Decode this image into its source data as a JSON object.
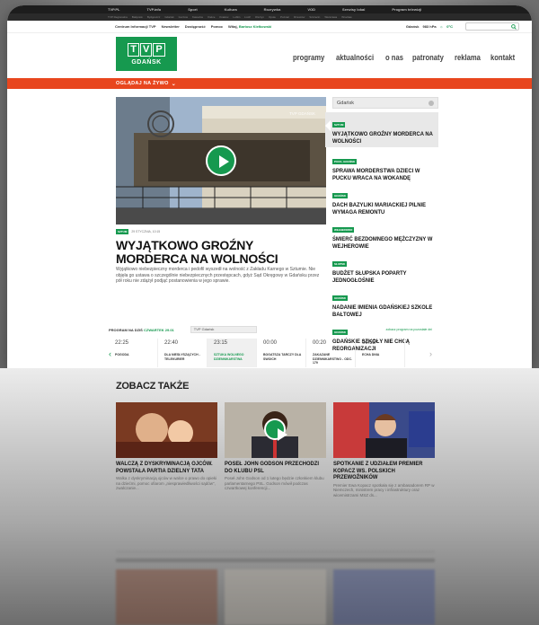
{
  "topnav": [
    "TVP.PL",
    "TVP.info",
    "Sport",
    "Kultura",
    "Rozrywka",
    "VOD",
    "Serwisy lokal",
    "Program telewizji"
  ],
  "subnav": [
    "TVP Regionalna",
    "Białystok",
    "Bydgoszcz",
    "Gdańsk",
    "Gorzów",
    "Katowice",
    "Kielce",
    "Kraków",
    "Lublin",
    "Łódź",
    "Olsztyn",
    "Opole",
    "Poznań",
    "Rzeszów",
    "Szczecin",
    "Warszawa",
    "Wrocław"
  ],
  "util": {
    "info": "Centrum Informacji TVP",
    "newsletter": "Newsletter",
    "accessibility": "Dostępność",
    "help": "Pomoc",
    "greeting": "Witaj,",
    "user": "Bartosz Kiełkowski",
    "city": "Gdańsk",
    "pressure": "983 hPa",
    "temp": "0°C"
  },
  "logo": {
    "tvp": [
      "T",
      "V",
      "P"
    ],
    "city": "GDAŃSK"
  },
  "mainnav": [
    "programy",
    "aktualności",
    "o nas",
    "patronaty",
    "reklama",
    "kontakt"
  ],
  "live": "OGLĄDAJ NA ŻYWO",
  "hero": {
    "watermark": "TVP GDAŃSK",
    "tag": "SZTUM",
    "date": "29 STYCZNIA, 10:15",
    "headline": "WYJĄTKOWO GROŹNY MORDERCA NA WOLNOŚCI",
    "lede": "Wyjątkowo niebezpieczny morderca i pedofil wyszedł na wolność z Zakładu Karnego w Sztumie. Nie objęła go ustawa o szczególnie niebezpiecznych przestępcach, gdyż Sąd Okręgowy w Gdańsku przez pół roku nie zdążył podjąć postanowienia w jego sprawie."
  },
  "sidebar": {
    "select": "Gdańsk",
    "items": [
      {
        "tag": "SZTUM",
        "title": "WYJĄTKOWO GROŹNY MORDERCA NA WOLNOŚCI"
      },
      {
        "tag": "PUCK, GDAŃSK",
        "title": "SPRAWA MORDERSTWA DZIECI W PUCKU WRACA NA WOKANDĘ"
      },
      {
        "tag": "GDAŃSK",
        "title": "DACH BAZYLIKI MARIACKIEJ PILNIE WYMAGA REMONTU"
      },
      {
        "tag": "WEJHEROWO",
        "title": "ŚMIERĆ BEZDOMNEGO MĘŻCZYZNY W WEJHEROWIE"
      },
      {
        "tag": "SŁUPSK",
        "title": "BUDŻET SŁUPSKA POPARTY JEDNOGŁOŚNIE"
      },
      {
        "tag": "GDAŃSK",
        "title": "NADANIE IMIENIA GDAŃSKIEJ SZKOLE BAŁTOWEJ"
      },
      {
        "tag": "GDAŃSK",
        "title": "GDAŃSKIE SZKOŁY NIE CHCĄ REORGANIZACJI"
      }
    ]
  },
  "program": {
    "label": "PROGRAM NA DZIŚ",
    "day": "CZWARTEK 29.01",
    "channel": "TVP Gdańsk",
    "full": "zobacz program na pozostałe dni",
    "slots": [
      {
        "time": "22:25",
        "name": "POGODA"
      },
      {
        "time": "22:40",
        "name": "DLA NIESŁYSZĄCYCH - TELEKURIER"
      },
      {
        "time": "23:15",
        "name": "SZTUKA WOLNEGO DZIENNIKARSTWA"
      },
      {
        "time": "00:00",
        "name": "BOGATSZA TARCZY DLA SWOICH"
      },
      {
        "time": "00:20",
        "name": "ZAKAZANE DZIENNIKARSTWO - ODC. 179"
      },
      {
        "time": "00:55",
        "name": "ECHA DNIA"
      }
    ]
  },
  "see_also": {
    "heading": "ZOBACZ TAKŻE",
    "cards": [
      {
        "title": "WALCZĄ Z DYSKRYMINACJĄ OJCÓW. POWSTAŁA PARTIA DZIELNY TATA",
        "excerpt": "Walka z dyskryminacją ojców w walce o prawo do opieki na dziećmi, pomoc ofiarom „niesprawiedliwości sądów”, zwalczanie..."
      },
      {
        "title": "POSEŁ JOHN GODSON PRZECHODZI DO KLUBU PSL",
        "excerpt": "Poseł John Godson od 1 lutego będzie członkiem klubu parlamentarnego PSL. Godson mówił podczas czwartkowej konferencji..."
      },
      {
        "title": "SPOTKANIE Z UDZIAŁEM PREMIER KOPACZ WS. POLSKICH PRZEWOŹNIKÓW",
        "excerpt": "Premier Ewa Kopacz spotkała się z ambasadorem RP w Niemczech, ministrem pracy i infrastruktury oraz wicemistrzami MSZ ds..."
      }
    ]
  },
  "colors": {
    "brand_green": "#16994f",
    "live_orange": "#e8461e"
  }
}
